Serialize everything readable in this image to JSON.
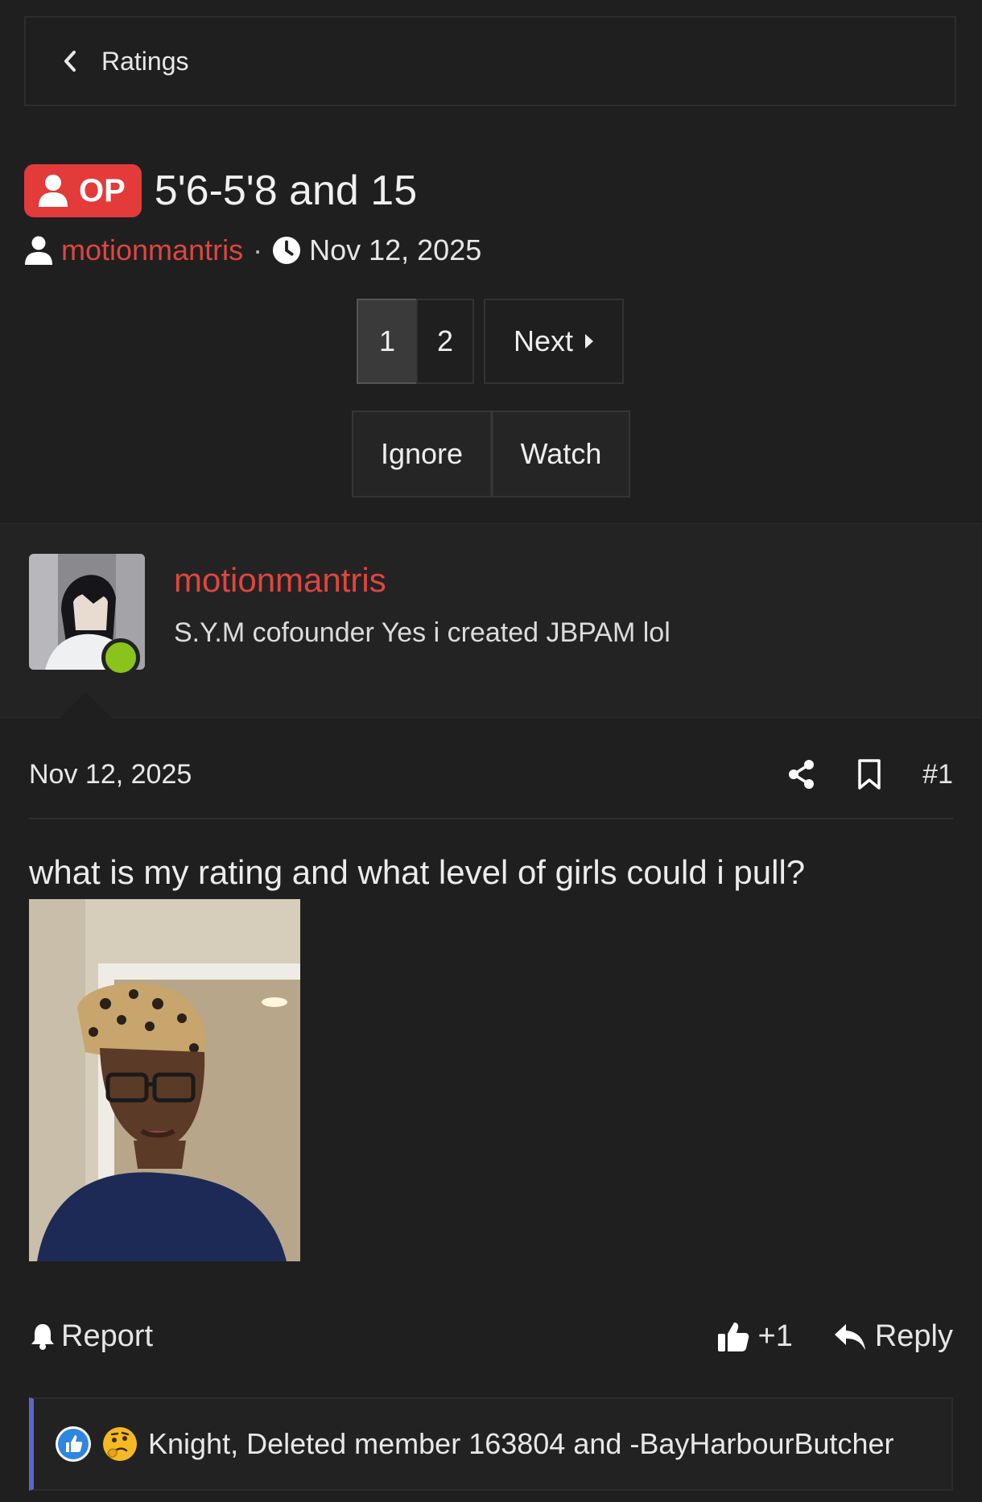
{
  "breadcrumb": {
    "label": "Ratings"
  },
  "thread": {
    "badge": "OP",
    "title": "5'6-5'8 and 15",
    "author": "motionmantris",
    "separator": "·",
    "date": "Nov 12, 2025"
  },
  "pagination": {
    "pages": [
      "1",
      "2"
    ],
    "current": "1",
    "next_label": "Next"
  },
  "actions": {
    "ignore": "Ignore",
    "watch": "Watch"
  },
  "user": {
    "name": "motionmantris",
    "user_title": "S.Y.M cofounder Yes i created JBPAM lol",
    "online": true
  },
  "post": {
    "date": "Nov 12, 2025",
    "number": "#1",
    "text": "what is my rating and what level of girls could i pull?",
    "report_label": "Report",
    "like_label": "+1",
    "reply_label": "Reply"
  },
  "reactions": {
    "text": "Knight, Deleted member 163804 and -BayHarbourButcher",
    "icons": [
      "like-icon",
      "thinking-face-icon"
    ]
  },
  "colors": {
    "background": "#1f1f20",
    "accent": "#e0453e",
    "badge": "#e33a3a",
    "online": "#8bc31d",
    "reaction_border": "#5d66c7"
  }
}
